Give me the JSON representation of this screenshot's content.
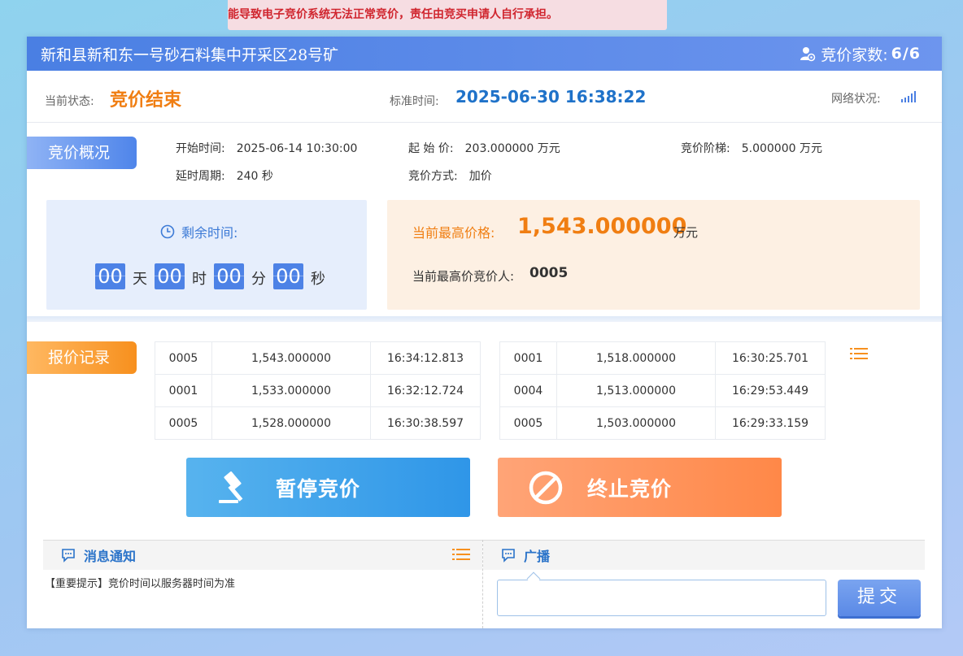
{
  "warning": "能导致电子竞价系统无法正常竞价，责任由竞买申请人自行承担。",
  "header": {
    "title": "新和县新和东一号砂石料集中开采区28号矿",
    "count_label": "竞价家数:",
    "count_value": "6/6"
  },
  "status": {
    "state_label": "当前状态:",
    "state_value": "竞价结束",
    "time_label": "标准时间:",
    "time_value": "2025-06-30 16:38:22",
    "network_label": "网络状况:"
  },
  "overview": {
    "tag": "竞价概况",
    "start_time_label": "开始时间:",
    "start_time": "2025-06-14 10:30:00",
    "start_price_label": "起 始 价:",
    "start_price": "203.000000 万元",
    "step_label": "竞价阶梯:",
    "step": "5.000000 万元",
    "delay_label": "延时周期:",
    "delay": "240 秒",
    "method_label": "竞价方式:",
    "method": "加价"
  },
  "countdown": {
    "title": "剩余时间:",
    "days": "00",
    "days_unit": "天",
    "hours": "00",
    "hours_unit": "时",
    "minutes": "00",
    "minutes_unit": "分",
    "seconds": "00",
    "seconds_unit": "秒"
  },
  "highest": {
    "price_label": "当前最高价格:",
    "price": "1,543.000000",
    "unit": "万元",
    "bidder_label": "当前最高价竞价人:",
    "bidder": "0005"
  },
  "records": {
    "tag": "报价记录",
    "left": [
      [
        "0005",
        "1,543.000000",
        "16:34:12.813"
      ],
      [
        "0001",
        "1,533.000000",
        "16:32:12.724"
      ],
      [
        "0005",
        "1,528.000000",
        "16:30:38.597"
      ]
    ],
    "right": [
      [
        "0001",
        "1,518.000000",
        "16:30:25.701"
      ],
      [
        "0004",
        "1,513.000000",
        "16:29:53.449"
      ],
      [
        "0005",
        "1,503.000000",
        "16:29:33.159"
      ]
    ]
  },
  "buttons": {
    "pause": "暂停竞价",
    "stop": "终止竞价",
    "submit": "提交"
  },
  "notice": {
    "title": "消息通知",
    "text": "【重要提示】竞价时间以服务器时间为准"
  },
  "broadcast": {
    "title": "广播",
    "placeholder": ""
  },
  "colors": {
    "primary": "#4a7fe3",
    "accent_orange": "#f07e12",
    "time_blue": "#1f72c9"
  }
}
